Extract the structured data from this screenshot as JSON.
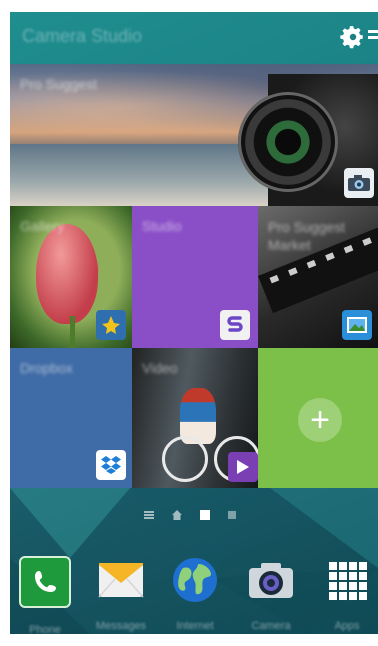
{
  "header": {
    "title": "Camera Studio",
    "settings_icon": "gear-icon",
    "menu_icon": "menu-icon"
  },
  "tiles": {
    "pro_suggest": {
      "label": "Pro Suggest",
      "icon": "camera-icon"
    },
    "gallery": {
      "label": "Gallery",
      "icon": "gallery-icon"
    },
    "studio": {
      "label": "Studio",
      "icon": "studio-icon"
    },
    "pro_suggest_market": {
      "label": "Pro Suggest Market",
      "icon": "film-icon"
    },
    "dropbox": {
      "label": "Dropbox",
      "icon": "dropbox-icon"
    },
    "video": {
      "label": "Video",
      "icon": "play-icon"
    },
    "add": {
      "label": "+"
    }
  },
  "pages": {
    "count": 4,
    "active_index": 2
  },
  "dock": [
    {
      "label": "Phone",
      "icon": "phone-icon"
    },
    {
      "label": "Messages",
      "icon": "envelope-icon"
    },
    {
      "label": "Internet",
      "icon": "globe-icon"
    },
    {
      "label": "Camera",
      "icon": "camera-icon"
    },
    {
      "label": "Apps",
      "icon": "apps-grid-icon"
    }
  ],
  "colors": {
    "studio": "#8a4fc7",
    "dropbox": "#3f6ba6",
    "add": "#7cc04a",
    "topbar": "#1f8f8f"
  }
}
